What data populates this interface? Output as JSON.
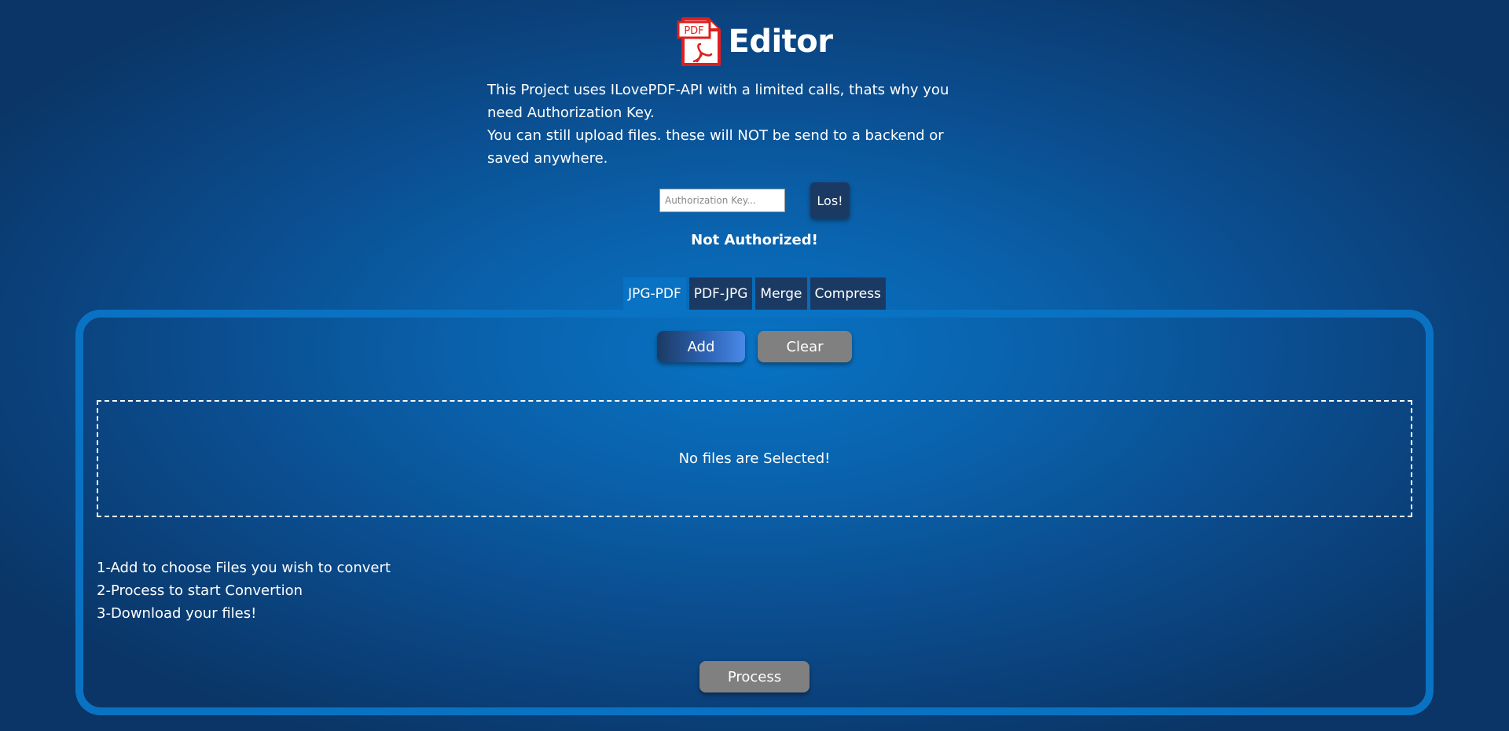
{
  "header": {
    "logo_icon": "pdf-file-icon",
    "logo_text": "PDF",
    "title": "Editor"
  },
  "intro": {
    "line1": "This Project uses ILovePDF-API with a limited calls, thats why you need Authorization Key.",
    "line2": "You can still upload files. these will NOT be send to a backend or saved anywhere."
  },
  "auth": {
    "placeholder": "Authorization Key...",
    "value": "",
    "button_label": "Los!",
    "status": "Not Authorized!"
  },
  "tabs": [
    {
      "label": "JPG-PDF",
      "active": true
    },
    {
      "label": "PDF-JPG",
      "active": false
    },
    {
      "label": "Merge",
      "active": false
    },
    {
      "label": "Compress",
      "active": false
    }
  ],
  "panel": {
    "add_label": "Add",
    "clear_label": "Clear",
    "empty_message": "No files are Selected!",
    "steps": [
      "1-Add to choose Files you wish to convert",
      "2-Process to start Convertion",
      "3-Download your files!"
    ],
    "process_label": "Process"
  },
  "colors": {
    "background_center": "#0873c4",
    "background_edge": "#0a3566",
    "accent": "#0a72c2",
    "dark_button": "#1b3a63",
    "gray_button": "#808080",
    "logo_red": "#e01e1e"
  }
}
